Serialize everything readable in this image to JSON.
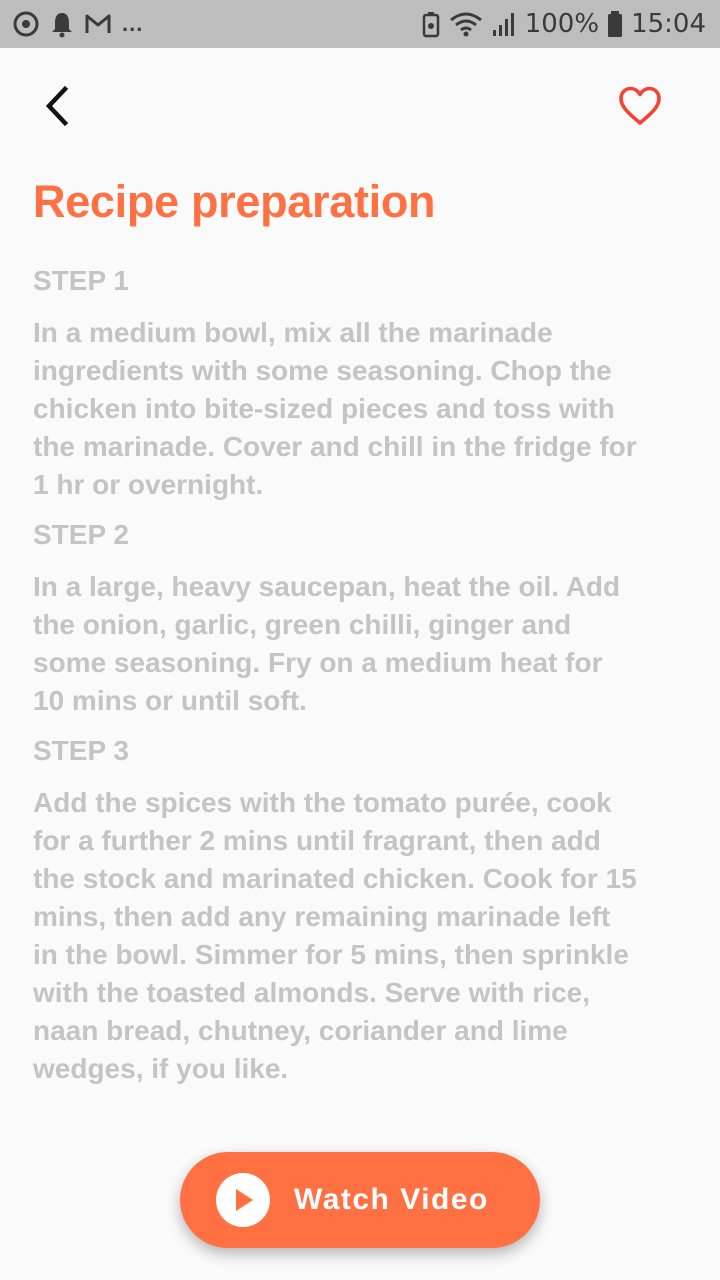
{
  "status_bar": {
    "notifications": "...",
    "battery_percent": "100%",
    "time": "15:04",
    "icons": [
      "sync-icon",
      "bell-icon",
      "gmail-icon",
      "battery-saver-icon",
      "wifi-icon",
      "signal-icon",
      "battery-icon"
    ]
  },
  "toolbar": {
    "back_icon": "chevron-left-icon",
    "favorite_icon": "heart-outline-icon",
    "favorite_color": "#f44336"
  },
  "page": {
    "title": "Recipe preparation",
    "accent_color": "#ff7043"
  },
  "steps": [
    {
      "label": "STEP 1",
      "lines": [
        "In a medium bowl, mix all the marinade",
        "ingredients with some seasoning. Chop the",
        "chicken into bite-sized pieces and toss with",
        "the marinade. Cover and chill in the fridge for",
        "1 hr or overnight."
      ]
    },
    {
      "label": "STEP 2",
      "lines": [
        "In a large, heavy saucepan, heat the oil. Add",
        "the onion, garlic, green chilli, ginger and",
        "some seasoning. Fry on a medium heat for",
        "10 mins or until soft."
      ]
    },
    {
      "label": "STEP 3",
      "lines": [
        "Add the spices with the tomato purée, cook",
        "for a further 2 mins until fragrant, then add",
        "the stock and marinated chicken. Cook for 15",
        "mins, then add any remaining marinade left",
        "in the bowl. Simmer for 5 mins, then sprinkle",
        "with the toasted almonds. Serve with rice,",
        "naan bread, chutney, coriander and lime",
        "wedges, if you like."
      ]
    }
  ],
  "video_button": {
    "label": "Watch Video",
    "icon": "play-icon"
  }
}
